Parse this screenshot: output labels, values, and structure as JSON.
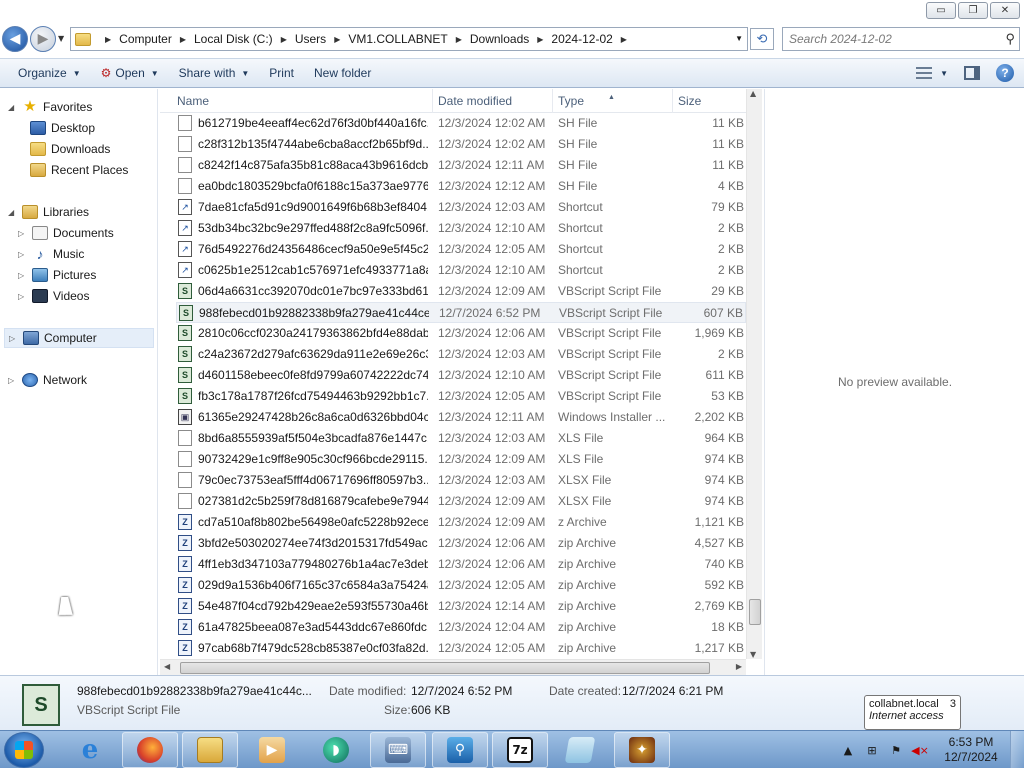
{
  "window": {
    "buttons": {
      "minimize": "▭",
      "maximize": "❐",
      "close": "✕"
    }
  },
  "address": {
    "crumbs": [
      "Computer",
      "Local Disk (C:)",
      "Users",
      "VM1.COLLABNET",
      "Downloads",
      "2024-12-02"
    ],
    "search_placeholder": "Search 2024-12-02"
  },
  "toolbar": {
    "organize": "Organize",
    "open": "Open",
    "share_with": "Share with",
    "print": "Print",
    "new_folder": "New folder"
  },
  "nav": {
    "favorites": "Favorites",
    "desktop": "Desktop",
    "downloads": "Downloads",
    "recent_places": "Recent Places",
    "libraries": "Libraries",
    "documents": "Documents",
    "music": "Music",
    "pictures": "Pictures",
    "videos": "Videos",
    "computer": "Computer",
    "network": "Network"
  },
  "columns": {
    "name": "Name",
    "date": "Date modified",
    "type": "Type",
    "size": "Size"
  },
  "files": [
    {
      "name": "b612719be4eeaff4ec62d76f3d0bf440a16fc...",
      "date": "12/3/2024 12:02 AM",
      "type": "SH File",
      "size": "11 KB",
      "icon": "file"
    },
    {
      "name": "c28f312b135f4744abe6cba8accf2b65bf9d...",
      "date": "12/3/2024 12:02 AM",
      "type": "SH File",
      "size": "11 KB",
      "icon": "file"
    },
    {
      "name": "c8242f14c875afa35b81c88aca43b9616dcb...",
      "date": "12/3/2024 12:11 AM",
      "type": "SH File",
      "size": "11 KB",
      "icon": "file"
    },
    {
      "name": "ea0bdc1803529bcfa0f6188c15a373ae9776...",
      "date": "12/3/2024 12:12 AM",
      "type": "SH File",
      "size": "4 KB",
      "icon": "file"
    },
    {
      "name": "7dae81cfa5d91c9d9001649f6b68b3ef8404...",
      "date": "12/3/2024 12:03 AM",
      "type": "Shortcut",
      "size": "79 KB",
      "icon": "shortcut"
    },
    {
      "name": "53db34bc32bc9e297ffed488f2c8a9fc5096f...",
      "date": "12/3/2024 12:10 AM",
      "type": "Shortcut",
      "size": "2 KB",
      "icon": "shortcut"
    },
    {
      "name": "76d5492276d24356486cecf9a50e9e5f45c2...",
      "date": "12/3/2024 12:05 AM",
      "type": "Shortcut",
      "size": "2 KB",
      "icon": "shortcut"
    },
    {
      "name": "c0625b1e2512cab1c576971efc4933771a8a...",
      "date": "12/3/2024 12:10 AM",
      "type": "Shortcut",
      "size": "2 KB",
      "icon": "shortcut"
    },
    {
      "name": "06d4a6631cc392070dc01e7bc97e333bd61...",
      "date": "12/3/2024 12:09 AM",
      "type": "VBScript Script File",
      "size": "29 KB",
      "icon": "vbs"
    },
    {
      "name": "988febecd01b92882338b9fa279ae41c44ce...",
      "date": "12/7/2024 6:52 PM",
      "type": "VBScript Script File",
      "size": "607 KB",
      "icon": "vbs",
      "selected": true
    },
    {
      "name": "2810c06ccf0230a24179363862bfd4e88dab...",
      "date": "12/3/2024 12:06 AM",
      "type": "VBScript Script File",
      "size": "1,969 KB",
      "icon": "vbs"
    },
    {
      "name": "c24a23672d279afc63629da911e2e69e26c3...",
      "date": "12/3/2024 12:03 AM",
      "type": "VBScript Script File",
      "size": "2 KB",
      "icon": "vbs"
    },
    {
      "name": "d4601158ebeec0fe8fd9799a60742222dc74...",
      "date": "12/3/2024 12:10 AM",
      "type": "VBScript Script File",
      "size": "611 KB",
      "icon": "vbs"
    },
    {
      "name": "fb3c178a1787f26fcd75494463b9292bb1c7...",
      "date": "12/3/2024 12:05 AM",
      "type": "VBScript Script File",
      "size": "53 KB",
      "icon": "vbs"
    },
    {
      "name": "61365e29247428b26c8a6ca0d6326bbd04c...",
      "date": "12/3/2024 12:11 AM",
      "type": "Windows Installer ...",
      "size": "2,202 KB",
      "icon": "msi"
    },
    {
      "name": "8bd6a8555939af5f504e3bcadfa876e1447c...",
      "date": "12/3/2024 12:03 AM",
      "type": "XLS File",
      "size": "964 KB",
      "icon": "file"
    },
    {
      "name": "90732429e1c9ff8e905c30cf966bcde29115...",
      "date": "12/3/2024 12:09 AM",
      "type": "XLS File",
      "size": "974 KB",
      "icon": "file"
    },
    {
      "name": "79c0ec73753eaf5fff4d06717696ff80597b3...",
      "date": "12/3/2024 12:03 AM",
      "type": "XLSX File",
      "size": "974 KB",
      "icon": "file"
    },
    {
      "name": "027381d2c5b259f78d816879cafebe9e7944...",
      "date": "12/3/2024 12:09 AM",
      "type": "XLSX File",
      "size": "974 KB",
      "icon": "file"
    },
    {
      "name": "cd7a510af8b802be56498e0afc5228b92ece...",
      "date": "12/3/2024 12:09 AM",
      "type": "z Archive",
      "size": "1,121 KB",
      "icon": "zip"
    },
    {
      "name": "3bfd2e503020274ee74f3d2015317fd549ac...",
      "date": "12/3/2024 12:06 AM",
      "type": "zip Archive",
      "size": "4,527 KB",
      "icon": "zip"
    },
    {
      "name": "4ff1eb3d347103a779480276b1a4ac7e3deb...",
      "date": "12/3/2024 12:06 AM",
      "type": "zip Archive",
      "size": "740 KB",
      "icon": "zip"
    },
    {
      "name": "029d9a1536b406f7165c37c6584a3a75424a...",
      "date": "12/3/2024 12:05 AM",
      "type": "zip Archive",
      "size": "592 KB",
      "icon": "zip"
    },
    {
      "name": "54e487f04cd792b429eae2e593f55730a46b...",
      "date": "12/3/2024 12:14 AM",
      "type": "zip Archive",
      "size": "2,769 KB",
      "icon": "zip"
    },
    {
      "name": "61a47825beea087e3ad5443ddc67e860fdc...",
      "date": "12/3/2024 12:04 AM",
      "type": "zip Archive",
      "size": "18 KB",
      "icon": "zip"
    },
    {
      "name": "97cab68b7f479dc528cb85387e0cf03fa82d...",
      "date": "12/3/2024 12:05 AM",
      "type": "zip Archive",
      "size": "1,217 KB",
      "icon": "zip"
    }
  ],
  "preview": {
    "text": "No preview available."
  },
  "details": {
    "name": "988febecd01b92882338b9fa279ae41c44c...",
    "type": "VBScript Script File",
    "date_modified_label": "Date modified:",
    "date_modified": "12/7/2024 6:52 PM",
    "date_created_label": "Date created:",
    "date_created": "12/7/2024 6:21 PM",
    "size_label": "Size:",
    "size": "606 KB"
  },
  "tooltip": {
    "line1": "collabnet.local",
    "line2": "Internet access",
    "count": "3"
  },
  "taskbar": {
    "apps": [
      "internet-explorer",
      "firefox",
      "windows-explorer",
      "media-player",
      "app-green",
      "network-tool",
      "magnifier",
      "7zip",
      "notepad",
      "game"
    ],
    "time": "6:53 PM",
    "date": "12/7/2024"
  }
}
